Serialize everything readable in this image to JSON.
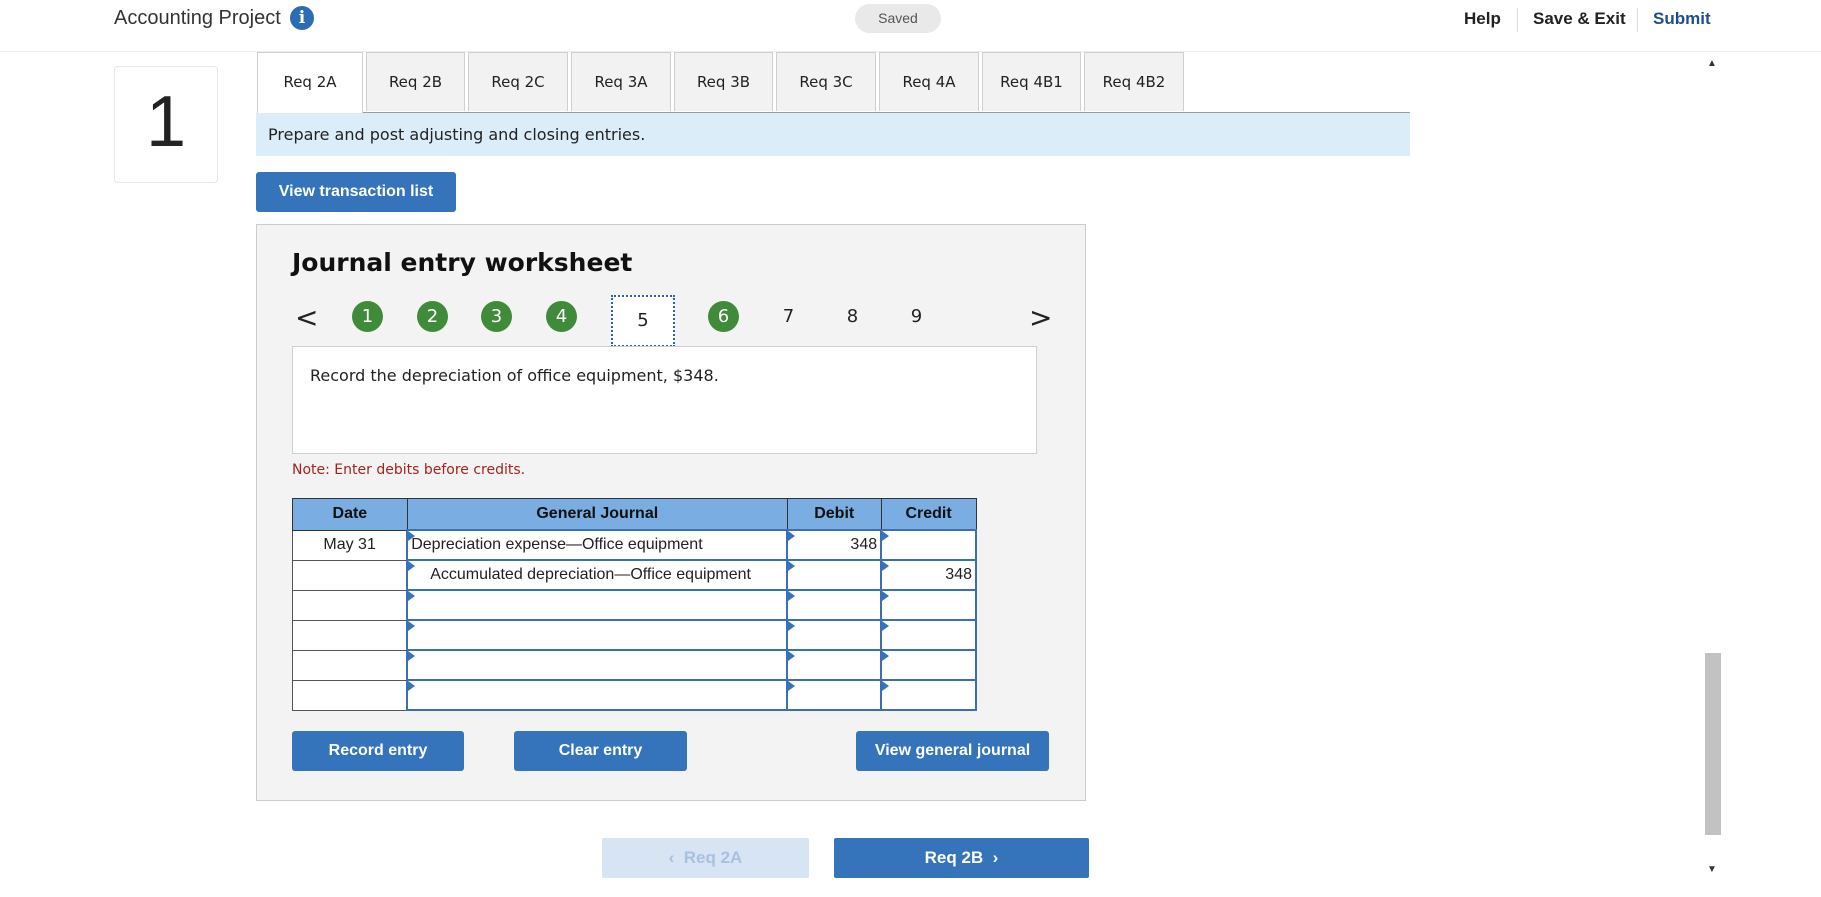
{
  "header": {
    "app_title": "Accounting Project",
    "info_icon": "i",
    "saved_status": "Saved",
    "help": "Help",
    "save_exit": "Save & Exit",
    "submit": "Submit"
  },
  "question_number": "1",
  "tabs": [
    {
      "label": "Req 2A"
    },
    {
      "label": "Req 2B"
    },
    {
      "label": "Req 2C"
    },
    {
      "label": "Req 3A"
    },
    {
      "label": "Req 3B"
    },
    {
      "label": "Req 3C"
    },
    {
      "label": "Req 4A"
    },
    {
      "label": "Req 4B1"
    },
    {
      "label": "Req 4B2"
    }
  ],
  "instruction": "Prepare and post adjusting and closing entries.",
  "view_transaction_list": "View transaction list",
  "worksheet": {
    "title": "Journal entry worksheet",
    "prev_arrow": "<",
    "next_arrow": ">",
    "steps": [
      "1",
      "2",
      "3",
      "4",
      "5",
      "6",
      "7",
      "8",
      "9"
    ],
    "current_step": "5",
    "description": "Record the depreciation of office equipment, $348.",
    "note": "Note: Enter debits before credits.",
    "columns": {
      "date": "Date",
      "journal": "General Journal",
      "debit": "Debit",
      "credit": "Credit"
    },
    "rows": [
      {
        "date": "May 31",
        "account": "Depreciation expense—Office equipment",
        "debit": "348",
        "credit": "",
        "indent": false
      },
      {
        "date": "",
        "account": "Accumulated depreciation—Office equipment",
        "debit": "",
        "credit": "348",
        "indent": true
      },
      {
        "date": "",
        "account": "",
        "debit": "",
        "credit": "",
        "indent": false
      },
      {
        "date": "",
        "account": "",
        "debit": "",
        "credit": "",
        "indent": false
      },
      {
        "date": "",
        "account": "",
        "debit": "",
        "credit": "",
        "indent": false
      },
      {
        "date": "",
        "account": "",
        "debit": "",
        "credit": "",
        "indent": false
      }
    ],
    "record_entry": "Record entry",
    "clear_entry": "Clear entry",
    "view_general_journal": "View general journal"
  },
  "nav": {
    "prev_label": "Req 2A",
    "next_label": "Req 2B"
  },
  "colors": {
    "accent_blue": "#3573bb",
    "step_done_green": "#3f8b3a",
    "header_row_blue": "#7aaee3",
    "instruction_bg": "#dcedfa",
    "note_red": "#a3231e"
  }
}
